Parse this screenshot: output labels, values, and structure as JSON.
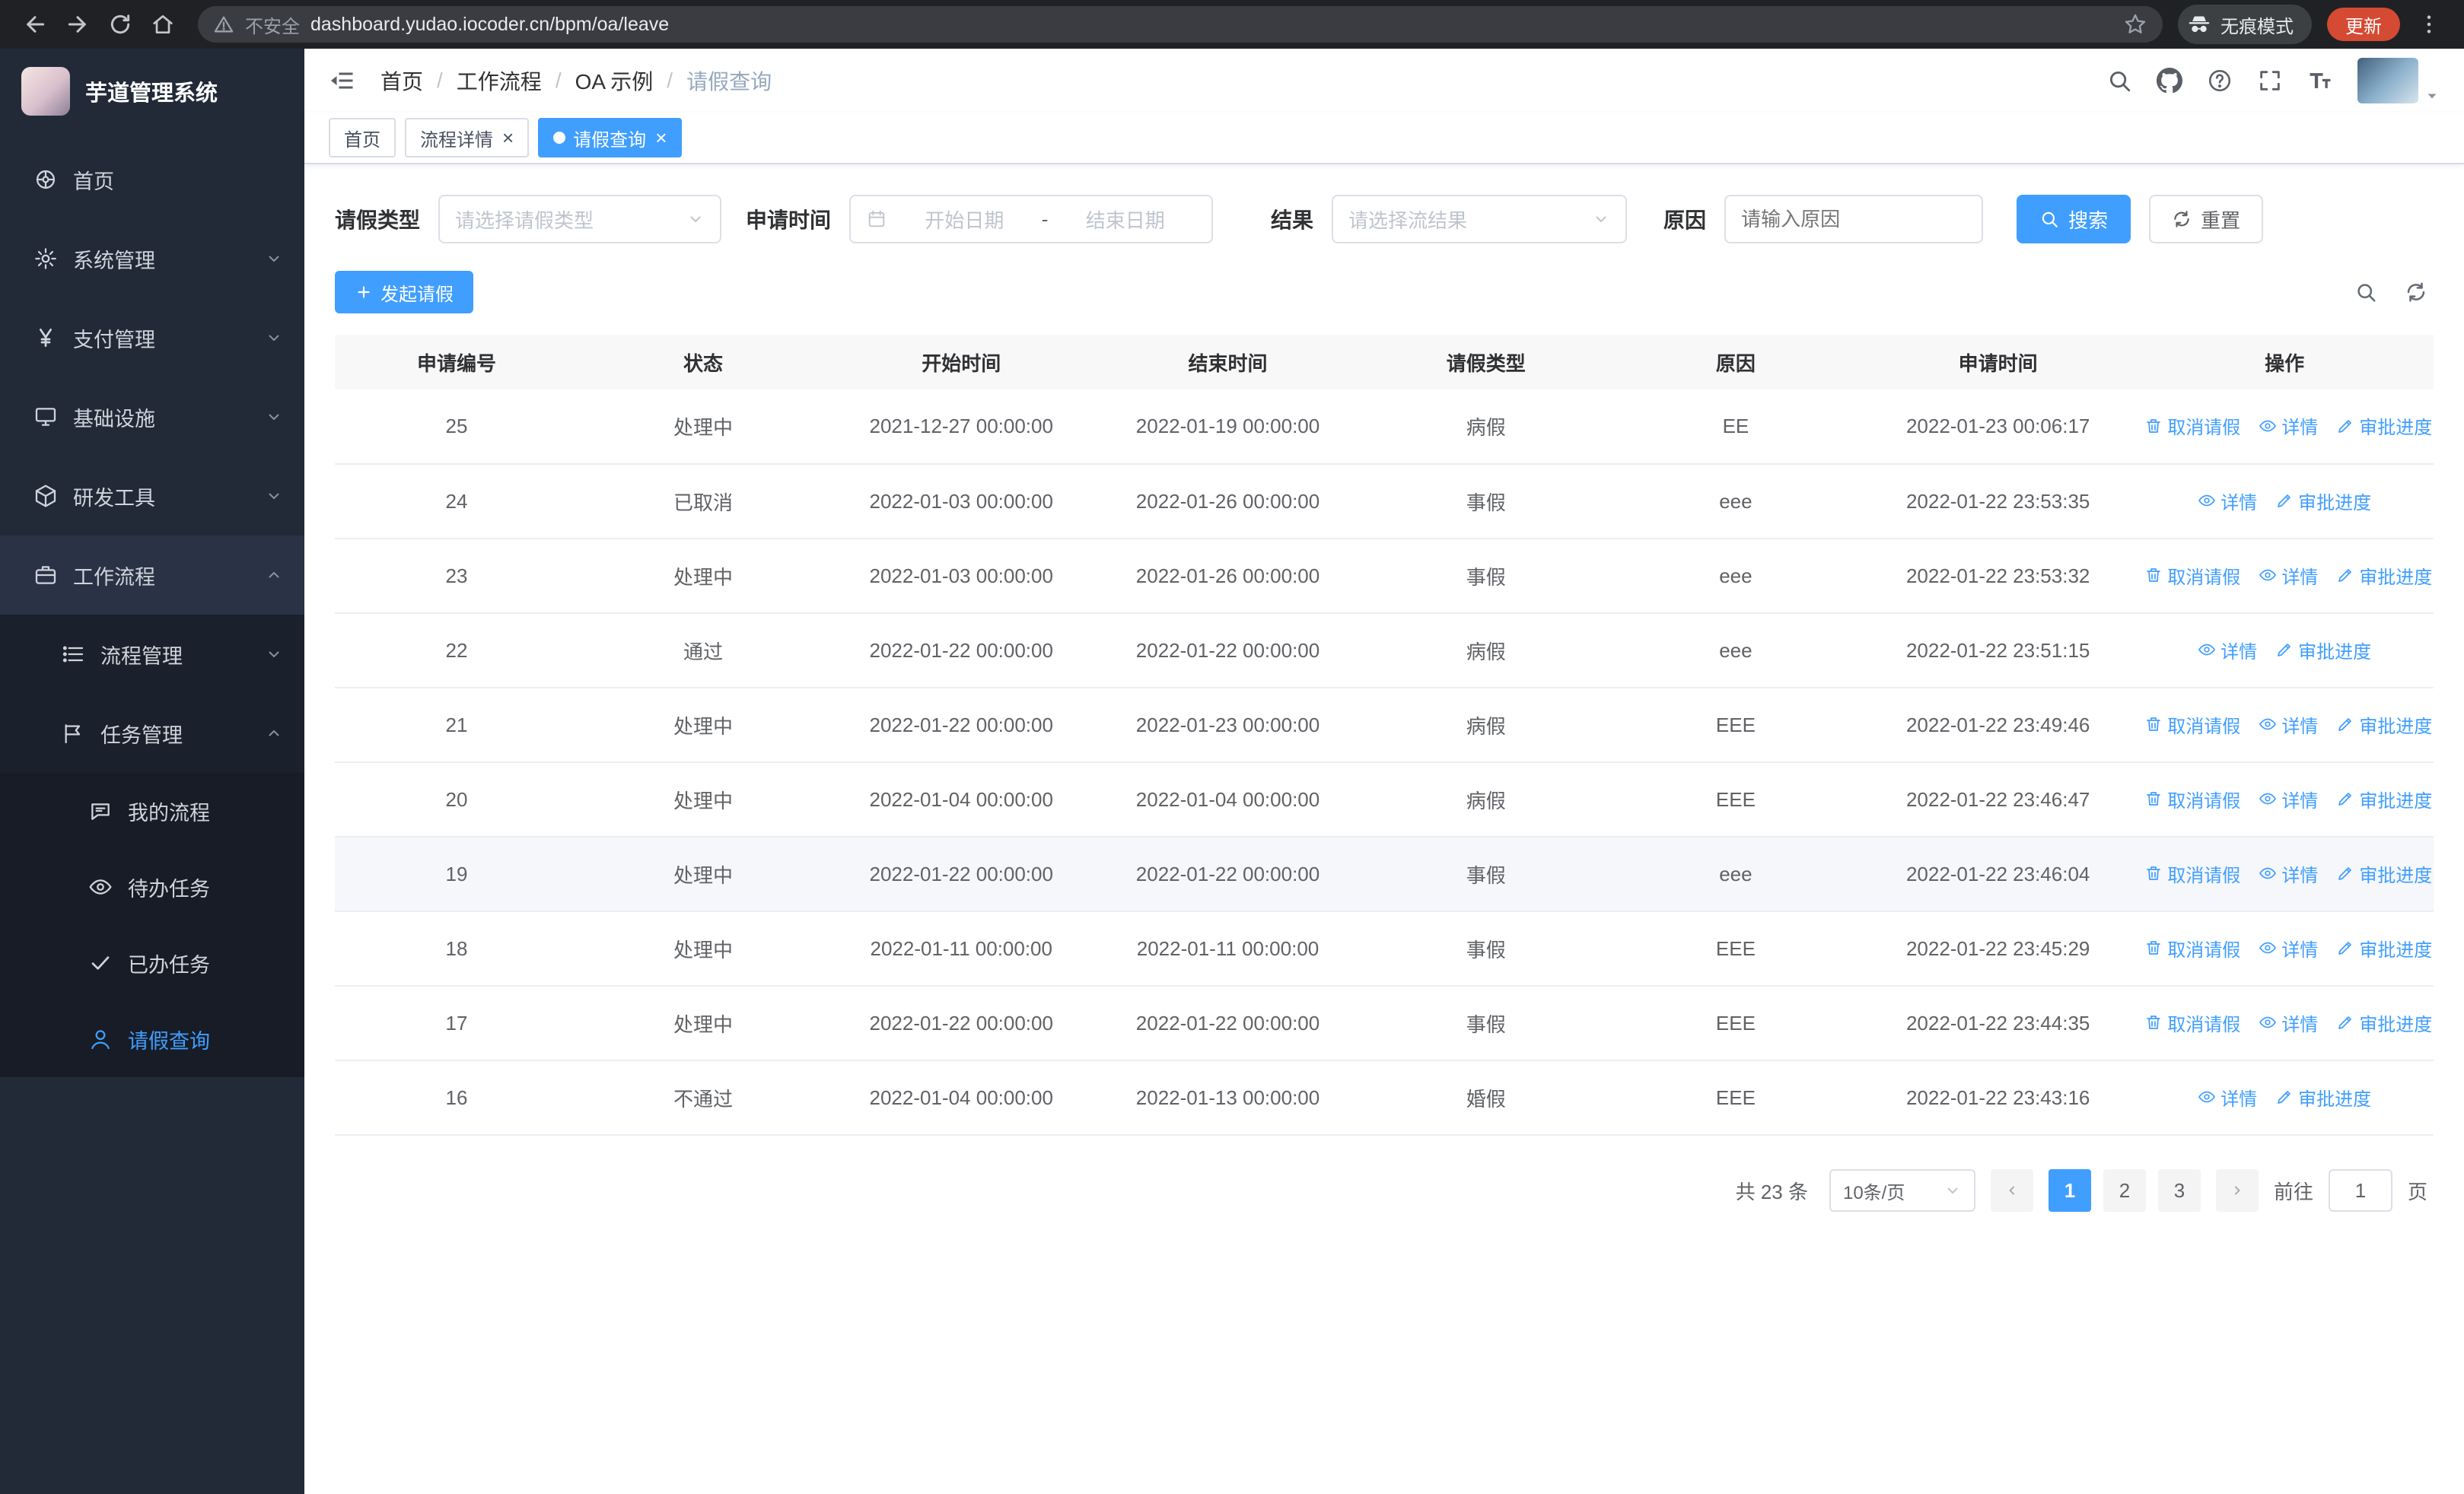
{
  "browser": {
    "security_warning": "不安全",
    "url": "dashboard.yudao.iocoder.cn/bpm/oa/leave",
    "incognito_label": "无痕模式",
    "update_label": "更新"
  },
  "colors": {
    "accent": "#409eff",
    "sidebar_bg": "#222a38",
    "chrome_bg": "#202124",
    "update_badge": "#d44a32"
  },
  "sidebar": {
    "app_title": "芋道管理系统",
    "menu": [
      {
        "name": "home",
        "label": "首页",
        "icon": "dashboard-icon"
      },
      {
        "name": "system",
        "label": "系统管理",
        "icon": "gear-icon",
        "chevron": "down"
      },
      {
        "name": "payment",
        "label": "支付管理",
        "icon": "yen-icon",
        "chevron": "down"
      },
      {
        "name": "infrastructure",
        "label": "基础设施",
        "icon": "monitor-icon",
        "chevron": "down"
      },
      {
        "name": "devtools",
        "label": "研发工具",
        "icon": "box-icon",
        "chevron": "down"
      },
      {
        "name": "workflow",
        "label": "工作流程",
        "icon": "briefcase-icon",
        "chevron": "up",
        "expanded": true,
        "children": [
          {
            "name": "process-mgmt",
            "label": "流程管理",
            "icon": "list-icon",
            "chevron": "down"
          },
          {
            "name": "task-mgmt",
            "label": "任务管理",
            "icon": "flag-icon",
            "chevron": "up",
            "expanded": true,
            "children": [
              {
                "name": "my-process",
                "label": "我的流程",
                "icon": "chat-icon"
              },
              {
                "name": "todo-tasks",
                "label": "待办任务",
                "icon": "eye-icon"
              },
              {
                "name": "done-tasks",
                "label": "已办任务",
                "icon": "check-icon"
              },
              {
                "name": "leave-query",
                "label": "请假查询",
                "icon": "user-icon",
                "active": true
              }
            ]
          }
        ]
      }
    ]
  },
  "header": {
    "breadcrumb": [
      {
        "label": "首页"
      },
      {
        "label": "工作流程"
      },
      {
        "label": "OA 示例"
      },
      {
        "label": "请假查询",
        "current": true
      }
    ]
  },
  "tabs": [
    {
      "name": "home",
      "label": "首页"
    },
    {
      "name": "process-detail",
      "label": "流程详情",
      "closable": true
    },
    {
      "name": "leave-query",
      "label": "请假查询",
      "closable": true,
      "active": true
    }
  ],
  "filters": {
    "type_label": "请假类型",
    "type_placeholder": "请选择请假类型",
    "time_label": "申请时间",
    "start_placeholder": "开始日期",
    "range_separator": "-",
    "end_placeholder": "结束日期",
    "result_label": "结果",
    "result_placeholder": "请选择流结果",
    "reason_label": "原因",
    "reason_placeholder": "请输入原因",
    "search_label": "搜索",
    "reset_label": "重置"
  },
  "toolbar": {
    "create_label": "发起请假"
  },
  "table": {
    "columns": [
      "申请编号",
      "状态",
      "开始时间",
      "结束时间",
      "请假类型",
      "原因",
      "申请时间",
      "操作"
    ],
    "action_labels": {
      "cancel": "取消请假",
      "detail": "详情",
      "progress": "审批进度"
    },
    "rows": [
      {
        "id": "25",
        "status": "处理中",
        "start": "2021-12-27 00:00:00",
        "end": "2022-01-19 00:00:00",
        "type": "病假",
        "reason": "EE",
        "applied": "2022-01-23 00:06:17",
        "cancellable": true
      },
      {
        "id": "24",
        "status": "已取消",
        "start": "2022-01-03 00:00:00",
        "end": "2022-01-26 00:00:00",
        "type": "事假",
        "reason": "eee",
        "applied": "2022-01-22 23:53:35",
        "cancellable": false
      },
      {
        "id": "23",
        "status": "处理中",
        "start": "2022-01-03 00:00:00",
        "end": "2022-01-26 00:00:00",
        "type": "事假",
        "reason": "eee",
        "applied": "2022-01-22 23:53:32",
        "cancellable": true
      },
      {
        "id": "22",
        "status": "通过",
        "start": "2022-01-22 00:00:00",
        "end": "2022-01-22 00:00:00",
        "type": "病假",
        "reason": "eee",
        "applied": "2022-01-22 23:51:15",
        "cancellable": false
      },
      {
        "id": "21",
        "status": "处理中",
        "start": "2022-01-22 00:00:00",
        "end": "2022-01-23 00:00:00",
        "type": "病假",
        "reason": "EEE",
        "applied": "2022-01-22 23:49:46",
        "cancellable": true
      },
      {
        "id": "20",
        "status": "处理中",
        "start": "2022-01-04 00:00:00",
        "end": "2022-01-04 00:00:00",
        "type": "病假",
        "reason": "EEE",
        "applied": "2022-01-22 23:46:47",
        "cancellable": true
      },
      {
        "id": "19",
        "status": "处理中",
        "start": "2022-01-22 00:00:00",
        "end": "2022-01-22 00:00:00",
        "type": "事假",
        "reason": "eee",
        "applied": "2022-01-22 23:46:04",
        "cancellable": true,
        "highlighted": true
      },
      {
        "id": "18",
        "status": "处理中",
        "start": "2022-01-11 00:00:00",
        "end": "2022-01-11 00:00:00",
        "type": "事假",
        "reason": "EEE",
        "applied": "2022-01-22 23:45:29",
        "cancellable": true
      },
      {
        "id": "17",
        "status": "处理中",
        "start": "2022-01-22 00:00:00",
        "end": "2022-01-22 00:00:00",
        "type": "事假",
        "reason": "EEE",
        "applied": "2022-01-22 23:44:35",
        "cancellable": true
      },
      {
        "id": "16",
        "status": "不通过",
        "start": "2022-01-04 00:00:00",
        "end": "2022-01-13 00:00:00",
        "type": "婚假",
        "reason": "EEE",
        "applied": "2022-01-22 23:43:16",
        "cancellable": false
      }
    ]
  },
  "pagination": {
    "total_label": "共 23 条",
    "page_size_value": "10条/页",
    "pages": [
      "1",
      "2",
      "3"
    ],
    "active_page": "1",
    "goto_label": "前往",
    "goto_value": "1",
    "goto_suffix": "页"
  }
}
